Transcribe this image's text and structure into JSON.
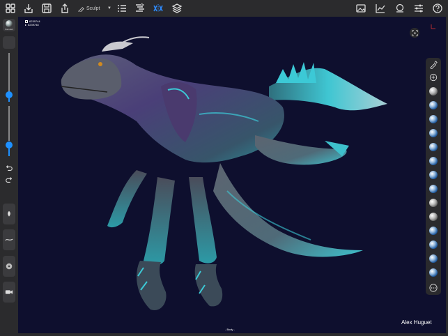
{
  "toolbar": {
    "sculpt_label": "Sculpt",
    "icons": [
      "grid-icon",
      "import-icon",
      "save-icon",
      "share-icon",
      "brush-icon",
      "list-icon",
      "subdivide-icon",
      "symmetry-icon",
      "layers-icon",
      "image-icon",
      "chart-icon",
      "materials-icon",
      "sliders-icon",
      "help-icon"
    ]
  },
  "left_panel": {
    "matcap_label": "Standard"
  },
  "viewport": {
    "stats": [
      "6239744",
      "6239748"
    ],
    "author": "Alex Huguet",
    "object_label": "- Body -"
  },
  "colors": {
    "viewport_bg": "#0e0f2e",
    "accent": "#1e90ff",
    "creature_teal": "#39c9d4",
    "creature_purple": "#5a4a8a"
  }
}
